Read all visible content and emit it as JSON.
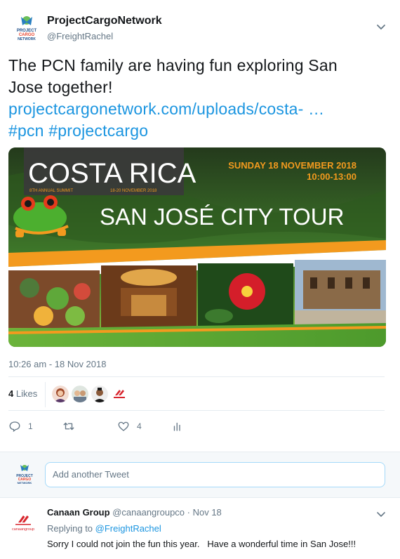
{
  "tweet": {
    "author_name": "ProjectCargoNetwork",
    "author_handle": "@FreightRachel",
    "avatar_text": [
      "PROJECT",
      "CARGO",
      "NETWORK"
    ],
    "text_line1": "The PCN family are having fun exploring San",
    "text_line2": "Jose together!",
    "link": "projectcargonetwork.com/uploads/costa- …",
    "hashtags": [
      "#pcn",
      "#projectcargo"
    ],
    "timestamp": "10:26 am - 18 Nov 2018",
    "likes_number": "4",
    "likes_label": " Likes",
    "reply_count": "1",
    "retweet_count": "",
    "like_count": "4"
  },
  "media": {
    "title": "COSTA RICA",
    "summary_label": "8TH ANNUAL SUMMIT",
    "summary_dates": "18-20 NOVEMBER 2018",
    "event_date": "SUNDAY 18 NOVEMBER 2018",
    "event_time": "10:00-13:00",
    "tour_title": "SAN JOSÉ CITY TOUR"
  },
  "reply_box": {
    "placeholder": "Add another Tweet"
  },
  "reply": {
    "author_name": "Canaan Group",
    "author_handle": "@canaangroupco",
    "separator": " · ",
    "date": "Nov 18",
    "replying_prefix": "Replying to ",
    "replying_to": "@FreightRachel",
    "body": "Sorry I could not join the fun this year.   Have a wonderful time in San Jose!!!",
    "logo_text": "canaangroup"
  },
  "colors": {
    "link": "#1b95e0",
    "muted": "#657786",
    "banner_orange": "#f39a1e",
    "banner_green": "#3f8f2a"
  }
}
